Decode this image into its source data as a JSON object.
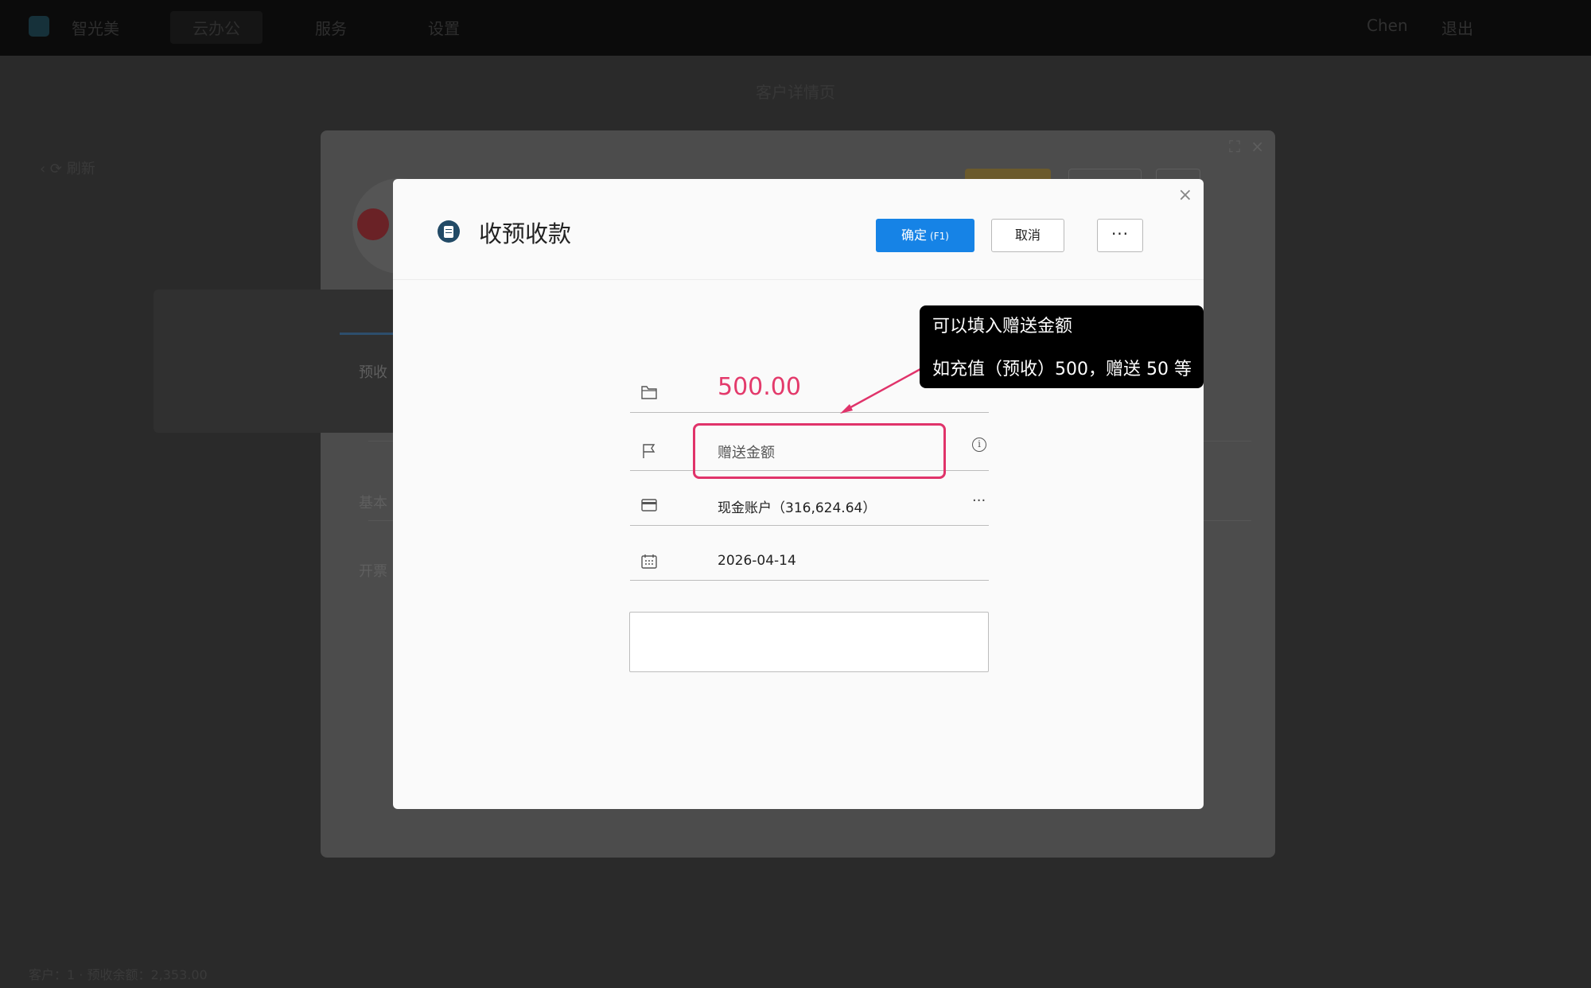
{
  "topbar": {
    "app_name": "智光美",
    "nav": [
      "云办公",
      "服务",
      "设置"
    ],
    "right": [
      "Chen",
      "退出"
    ]
  },
  "page": {
    "title": "客户详情页",
    "footer": "客户：1 · 预收余额：2,353.00"
  },
  "outer_modal": {
    "labels": [
      "预收",
      "基本",
      "开票"
    ]
  },
  "dialog": {
    "title": "收预收款",
    "confirm_label": "确定",
    "confirm_shortcut": "(F1)",
    "cancel_label": "取消",
    "more_label": "···",
    "close_label": "×",
    "amount": "500.00",
    "gift_placeholder": "赠送金额",
    "info_label": "i",
    "account": "现金账户（316,624.64）",
    "account_more": "···",
    "date": "2026-04-14",
    "memo": ""
  },
  "callout": {
    "line1": "可以填入赠送金额",
    "line2": "如充值（预收）500，赠送 50 等"
  },
  "colors": {
    "primary": "#1683e6",
    "amount": "#e33a6b",
    "highlight": "#e0336a",
    "callout_bg": "#000000"
  }
}
